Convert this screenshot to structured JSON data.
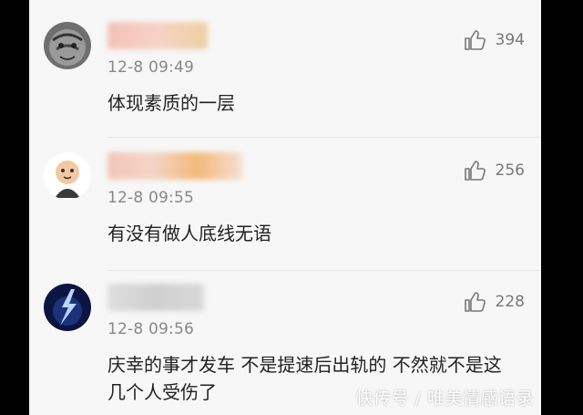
{
  "comments": [
    {
      "time": "12-8 09:49",
      "text": "体现素质的一层",
      "likes": "394",
      "avatar_icon": "tiger-avatar"
    },
    {
      "time": "12-8 09:55",
      "text": "有没有做人底线无语",
      "likes": "256",
      "avatar_icon": "cartoon-avatar"
    },
    {
      "time": "12-8 09:56",
      "text": "庆幸的事才发车 不是提速后出轨的 不然就不是这几个人受伤了",
      "likes": "228",
      "avatar_icon": "lightning-avatar"
    }
  ],
  "watermark": "快传号 / 唯美情感语录",
  "like_icon": "thumbs-up-icon"
}
